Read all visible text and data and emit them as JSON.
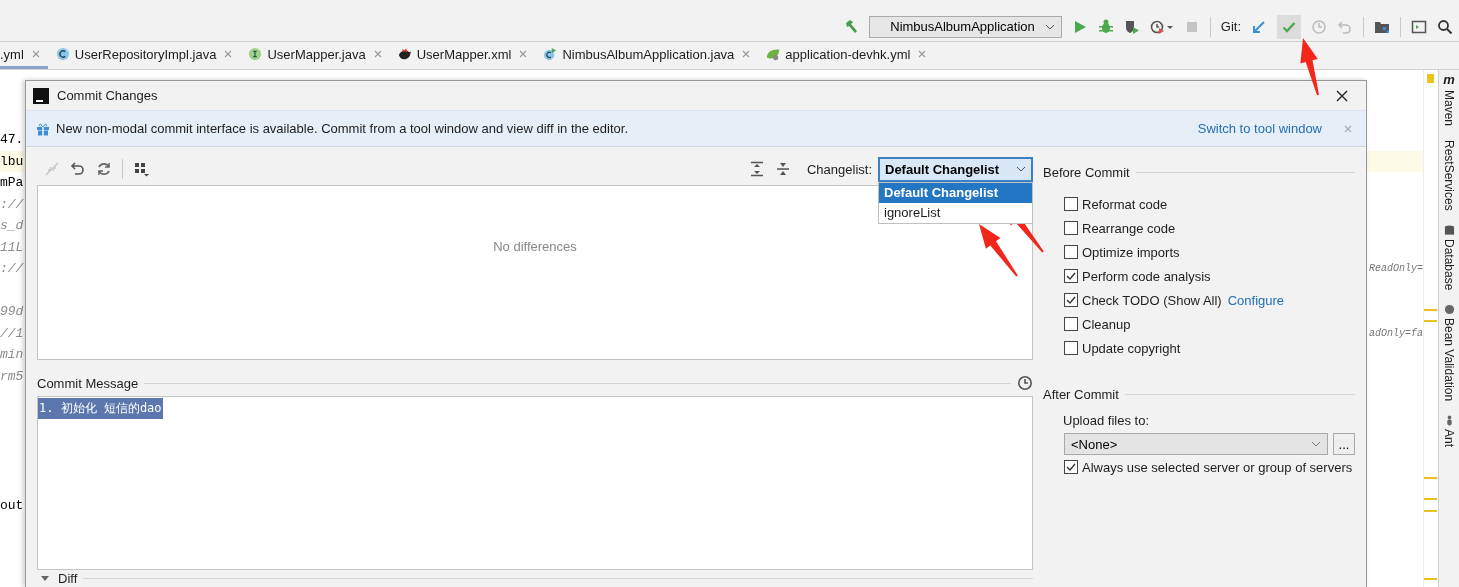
{
  "toolbar": {
    "run_config": "NimbusAlbumApplication",
    "vcs_label": "Git:"
  },
  "tabs": [
    {
      "label": ".yml",
      "selected": true,
      "kind": "yaml"
    },
    {
      "label": "UserRepositoryImpl.java",
      "selected": false,
      "kind": "class"
    },
    {
      "label": "UserMapper.java",
      "selected": false,
      "kind": "interface"
    },
    {
      "label": "UserMapper.xml",
      "selected": false,
      "kind": "mybatis"
    },
    {
      "label": "NimbusAlbumApplication.java",
      "selected": false,
      "kind": "app"
    },
    {
      "label": "application-devhk.yml",
      "selected": false,
      "kind": "spring"
    }
  ],
  "editor": {
    "lines": [
      {
        "kind": "code",
        "text": "47.",
        "current": false
      },
      {
        "kind": "code",
        "text": "lbu",
        "current": true
      },
      {
        "kind": "code",
        "text": "mPa",
        "current": false
      },
      {
        "kind": "comment",
        "text": "://",
        "current": false
      },
      {
        "kind": "comment",
        "text": "s_d",
        "current": false
      },
      {
        "kind": "comment",
        "text": "11L",
        "current": false
      },
      {
        "kind": "comment",
        "text": "://",
        "right": "ReadOnly=",
        "current": false
      },
      {
        "kind": "blank",
        "current": false
      },
      {
        "kind": "comment",
        "text": "99d",
        "current": false
      },
      {
        "kind": "comment",
        "text": "//1",
        "right": "adOnly=fa",
        "current": false
      },
      {
        "kind": "comment",
        "text": "min",
        "current": false
      },
      {
        "kind": "comment",
        "text": "rm5",
        "current": false
      },
      {
        "kind": "blank",
        "current": false
      },
      {
        "kind": "blank",
        "current": false
      },
      {
        "kind": "blank",
        "current": false
      },
      {
        "kind": "blank",
        "current": false
      },
      {
        "kind": "blank",
        "current": false
      },
      {
        "kind": "code",
        "text": "out",
        "current": false
      }
    ]
  },
  "tool_windows": [
    {
      "label": "Maven",
      "kind": "maven",
      "glyph": "m"
    },
    {
      "label": "RestServices",
      "kind": "plain"
    },
    {
      "label": "Database",
      "kind": "database"
    },
    {
      "label": "Bean Validation",
      "kind": "bean"
    },
    {
      "label": "Ant",
      "kind": "ant"
    }
  ],
  "dialog": {
    "title": "Commit Changes",
    "banner": {
      "text": "New non-modal commit interface is available. Commit from a tool window and view diff in the editor.",
      "link": "Switch to tool window"
    },
    "changelist": {
      "label": "Changelist:",
      "value": "Default Changelist",
      "expanded": true,
      "options": [
        {
          "label": "Default Changelist",
          "selected": true
        },
        {
          "label": "ignoreList",
          "selected": false
        }
      ]
    },
    "changes": {
      "empty_text": "No differences"
    },
    "commit_message": {
      "label": "Commit Message",
      "value": "1. 初始化 短信的dao",
      "selected": true
    },
    "diff": {
      "label": "Diff",
      "expanded": true
    },
    "before_commit": {
      "title": "Before Commit",
      "options": [
        {
          "label": "Reformat code",
          "checked": false
        },
        {
          "label": "Rearrange code",
          "checked": false
        },
        {
          "label": "Optimize imports",
          "checked": false
        },
        {
          "label": "Perform code analysis",
          "checked": true
        },
        {
          "label": "Check TODO (Show All)",
          "link": "Configure",
          "checked": true
        },
        {
          "label": "Cleanup",
          "checked": false
        },
        {
          "label": "Update copyright",
          "checked": false
        }
      ]
    },
    "after_commit": {
      "title": "After Commit",
      "upload_label": "Upload files to:",
      "server": "<None>",
      "browse": "...",
      "options": [
        {
          "label": "Always use selected server or group of servers",
          "checked": true
        }
      ]
    }
  }
}
